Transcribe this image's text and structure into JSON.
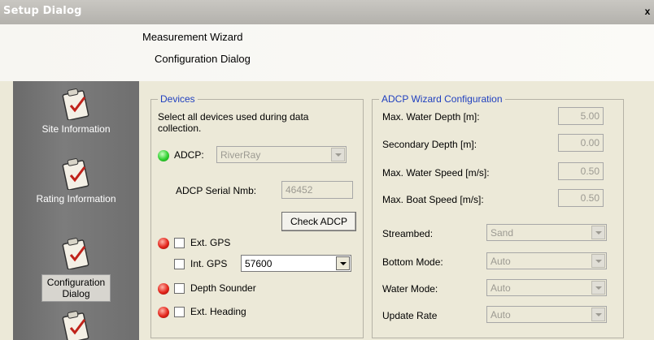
{
  "window": {
    "title": "Setup Dialog",
    "close_glyph": "x"
  },
  "header": {
    "wizard_title": "Measurement Wizard",
    "page_title": "Configuration Dialog"
  },
  "sidebar": {
    "items": [
      {
        "label": "Site Information",
        "icon": "clipboard-check-icon",
        "active": false
      },
      {
        "label": "Rating Information",
        "icon": "clipboard-check-icon",
        "active": false
      },
      {
        "label_line1": "Configuration",
        "label_line2": "Dialog",
        "icon": "clipboard-check-icon",
        "active": true
      },
      {
        "icon": "clipboard-check-icon",
        "active": false
      }
    ]
  },
  "devices": {
    "legend": "Devices",
    "instructions": "Select all devices used during data collection.",
    "adcp": {
      "label": "ADCP:",
      "status": "green",
      "selected": "RiverRay",
      "serial_label": "ADCP Serial Nmb:",
      "serial_value": "46452",
      "check_button": "Check ADCP"
    },
    "ext_gps": {
      "label": "Ext. GPS",
      "status": "red",
      "checked": false
    },
    "int_gps": {
      "label": "Int. GPS",
      "checked": false,
      "baud": "57600"
    },
    "depth_sounder": {
      "label": "Depth Sounder",
      "status": "red",
      "checked": false
    },
    "ext_heading": {
      "label": "Ext. Heading",
      "status": "red",
      "checked": false
    }
  },
  "adcp_config": {
    "legend": "ADCP Wizard Configuration",
    "max_water_depth": {
      "label": "Max. Water Depth [m]:",
      "value": "5.00"
    },
    "secondary_depth": {
      "label": "Secondary Depth [m]:",
      "value": "0.00"
    },
    "max_water_speed": {
      "label": "Max. Water Speed [m/s]:",
      "value": "0.50"
    },
    "max_boat_speed": {
      "label": "Max. Boat Speed [m/s]:",
      "value": "0.50"
    },
    "streambed": {
      "label": "Streambed:",
      "value": "Sand"
    },
    "bottom_mode": {
      "label": "Bottom Mode:",
      "value": "Auto"
    },
    "water_mode": {
      "label": "Water Mode:",
      "value": "Auto"
    },
    "update_rate": {
      "label": "Update Rate",
      "value": "Auto"
    }
  },
  "colors": {
    "legend_text": "#1f3fbf",
    "sidebar_bg": "#6f6f6f",
    "dialog_bg": "#ece9d8",
    "led_green": "#2fd02f",
    "led_red": "#e3241a"
  }
}
